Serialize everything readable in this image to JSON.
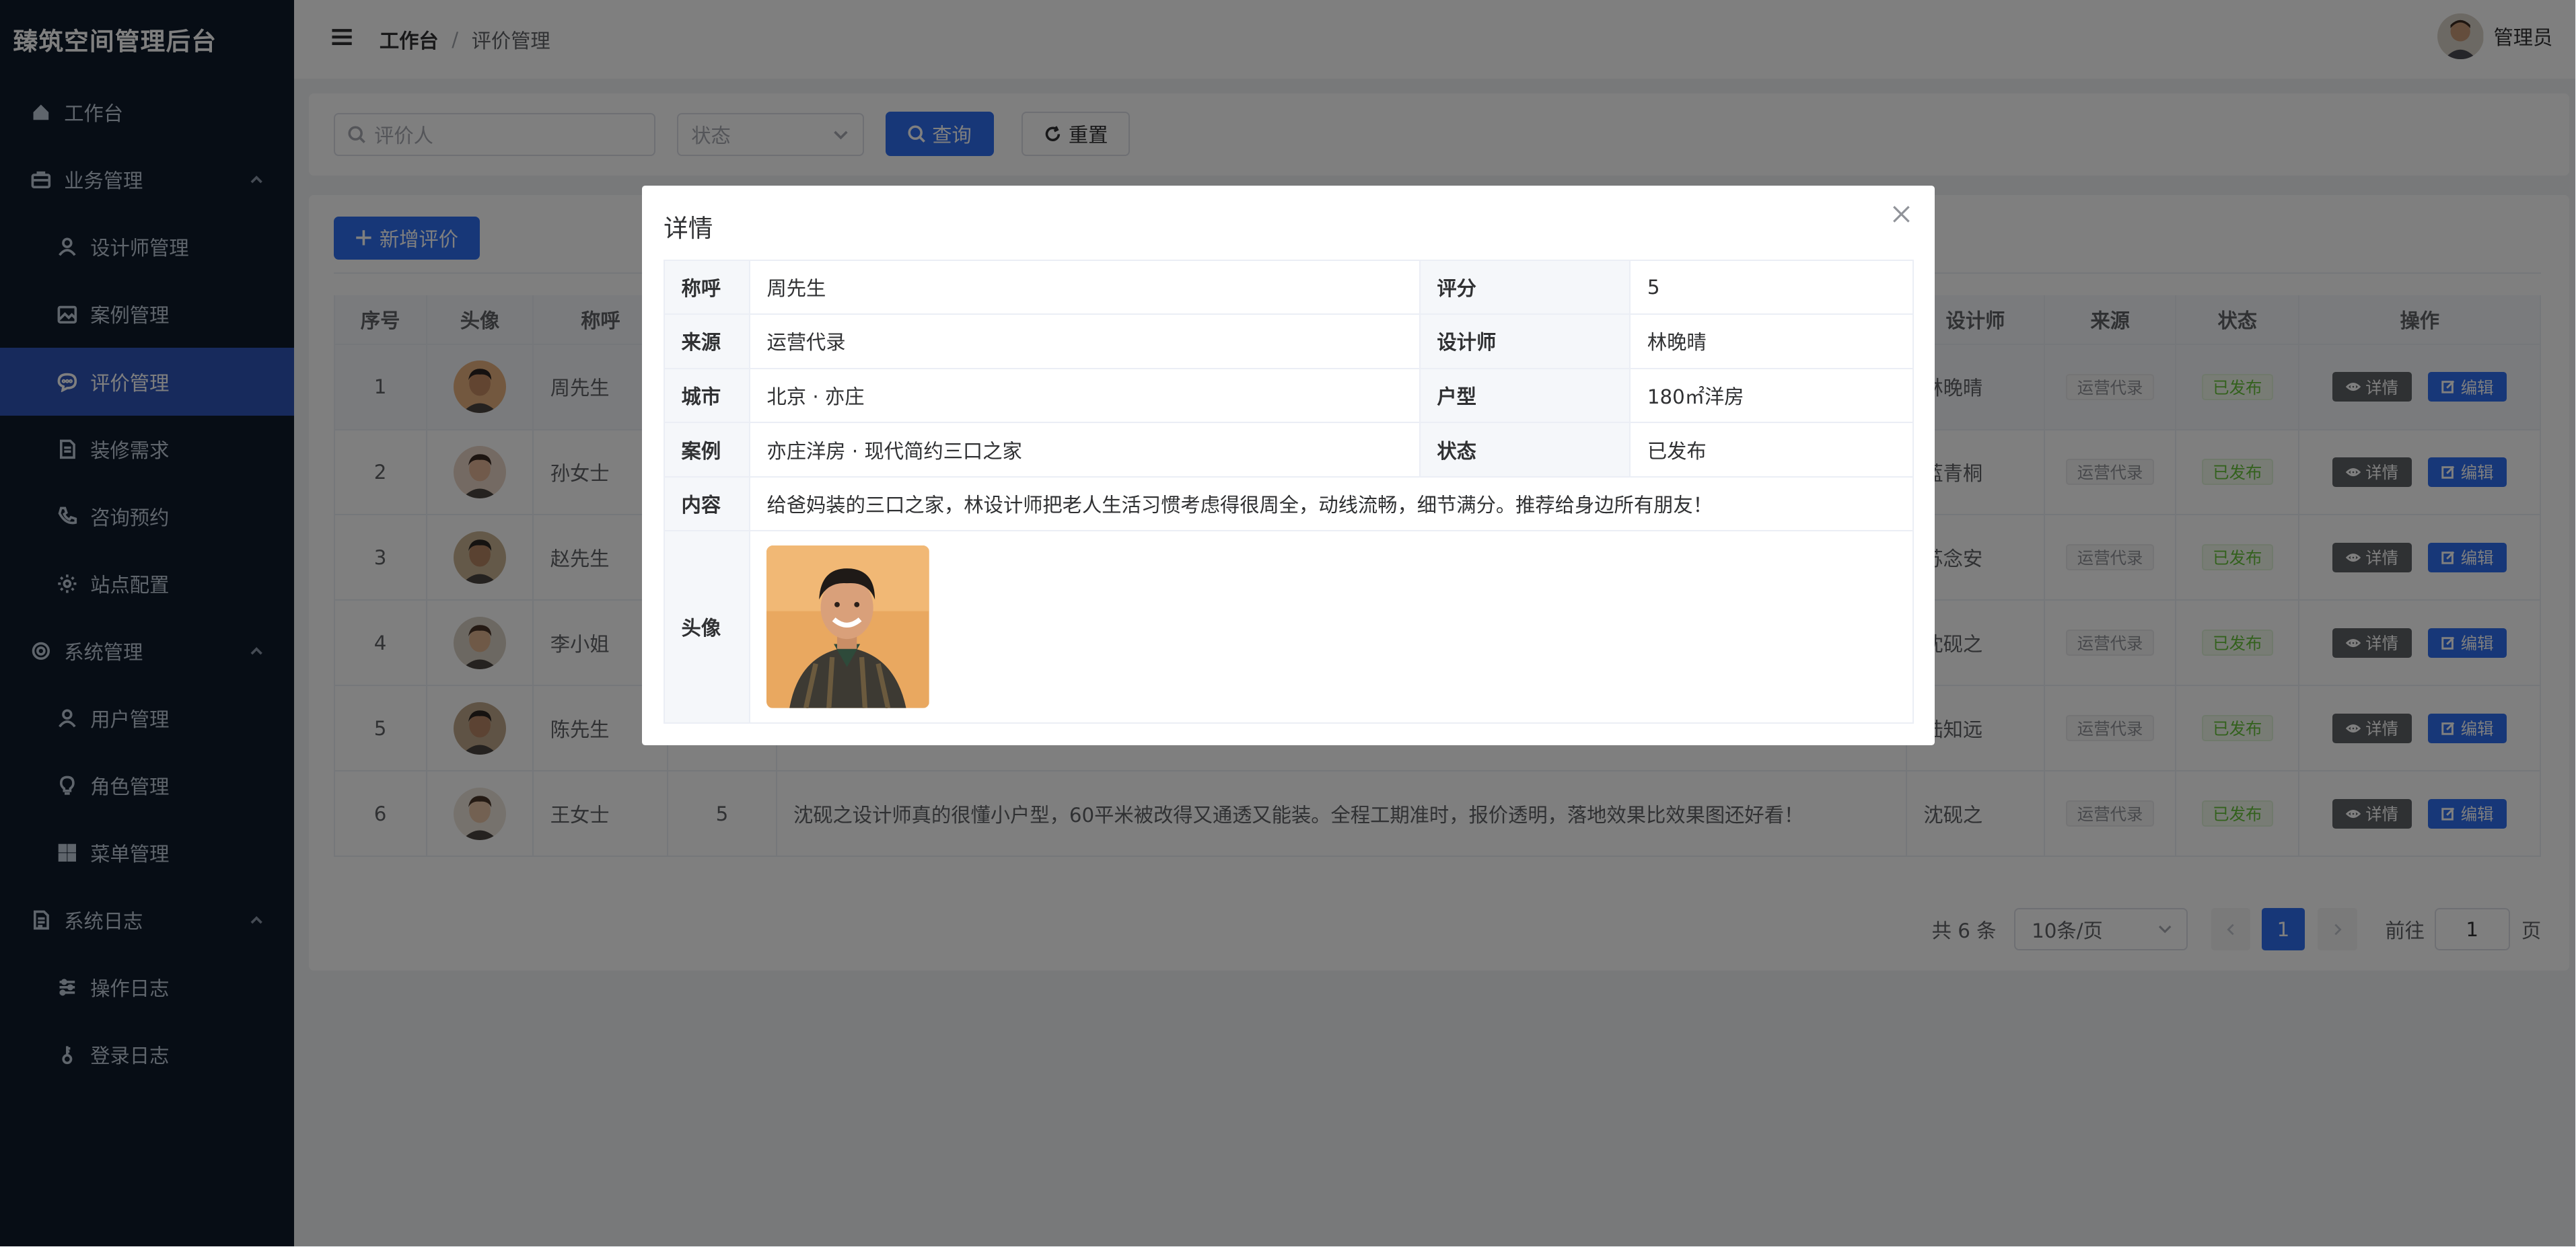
{
  "app": {
    "title": "臻筑空间管理后台"
  },
  "sidebar": {
    "items": [
      {
        "label": "工作台",
        "icon": "home-icon",
        "level": 0,
        "active": false
      },
      {
        "label": "业务管理",
        "icon": "briefcase-icon",
        "level": 0,
        "group": true
      },
      {
        "label": "设计师管理",
        "icon": "user-icon",
        "level": 1
      },
      {
        "label": "案例管理",
        "icon": "picture-icon",
        "level": 1
      },
      {
        "label": "评价管理",
        "icon": "chat-icon",
        "level": 1,
        "active": true
      },
      {
        "label": "装修需求",
        "icon": "document-icon",
        "level": 1
      },
      {
        "label": "咨询预约",
        "icon": "phone-icon",
        "level": 1
      },
      {
        "label": "站点配置",
        "icon": "gear-icon",
        "level": 1
      },
      {
        "label": "系统管理",
        "icon": "settings-icon",
        "level": 0,
        "group": true
      },
      {
        "label": "用户管理",
        "icon": "user-icon",
        "level": 1
      },
      {
        "label": "角色管理",
        "icon": "bulb-icon",
        "level": 1
      },
      {
        "label": "菜单管理",
        "icon": "grid-icon",
        "level": 1
      },
      {
        "label": "系统日志",
        "icon": "log-icon",
        "level": 0,
        "group": true
      },
      {
        "label": "操作日志",
        "icon": "sliders-icon",
        "level": 1
      },
      {
        "label": "登录日志",
        "icon": "key-icon",
        "level": 1
      }
    ]
  },
  "header": {
    "breadcrumb": [
      "工作台",
      "评价管理"
    ],
    "user_name": "管理员"
  },
  "search": {
    "reviewer_placeholder": "评价人",
    "status_placeholder": "状态",
    "query_label": "查询",
    "reset_label": "重置"
  },
  "toolbar": {
    "add_label": "新增评价"
  },
  "table": {
    "columns": [
      "序号",
      "头像",
      "称呼",
      "设计师",
      "来源",
      "状态",
      "操作"
    ],
    "rows": [
      {
        "no": "1",
        "name": "周先生",
        "designer": "林晚晴",
        "designer_visible": "林晚晴",
        "source": "运营代录",
        "status": "已发布"
      },
      {
        "no": "2",
        "name": "孙女士",
        "designer_visible": "蓝青桐",
        "source": "运营代录",
        "status": "已发布"
      },
      {
        "no": "3",
        "name": "赵先生",
        "designer_visible": "苏念安",
        "source": "运营代录",
        "status": "已发布"
      },
      {
        "no": "4",
        "name": "李小姐",
        "designer_visible": "沈砚之",
        "source": "运营代录",
        "status": "已发布"
      },
      {
        "no": "5",
        "name": "陈先生",
        "designer_visible": "陆知远",
        "source": "运营代录",
        "status": "已发布"
      },
      {
        "no": "6",
        "name": "王女士",
        "score": "5",
        "content": "沈砚之设计师真的很懂小户型，60平米被改得又通透又能装。全程工期准时，报价透明，落地效果比效果图还好看！",
        "designer_visible": "沈砚之",
        "source": "运营代录",
        "status": "已发布"
      }
    ],
    "op_detail": "详情",
    "op_edit": "编辑"
  },
  "pagination": {
    "total": "共 6 条",
    "page_size": "10条/页",
    "current": "1",
    "goto_prefix": "前往",
    "goto_value": "1",
    "goto_suffix": "页"
  },
  "dialog": {
    "title": "详情",
    "fields": {
      "name_label": "称呼",
      "name": "周先生",
      "score_label": "评分",
      "score": "5",
      "source_label": "来源",
      "source": "运营代录",
      "designer_label": "设计师",
      "designer": "林晚晴",
      "city_label": "城市",
      "city": "北京 · 亦庄",
      "layout_label": "户型",
      "layout": "180㎡洋房",
      "case_label": "案例",
      "case": "亦庄洋房 · 现代简约三口之家",
      "status_label": "状态",
      "status": "已发布",
      "content_label": "内容",
      "content": "给爸妈装的三口之家，林设计师把老人生活习惯考虑得很周全，动线流畅，细节满分。推荐给身边所有朋友！",
      "avatar_label": "头像"
    }
  },
  "colors": {
    "sidebar_bg": "#0f1a2b",
    "accent": "#2f6ff0",
    "published": "#67c23a"
  }
}
